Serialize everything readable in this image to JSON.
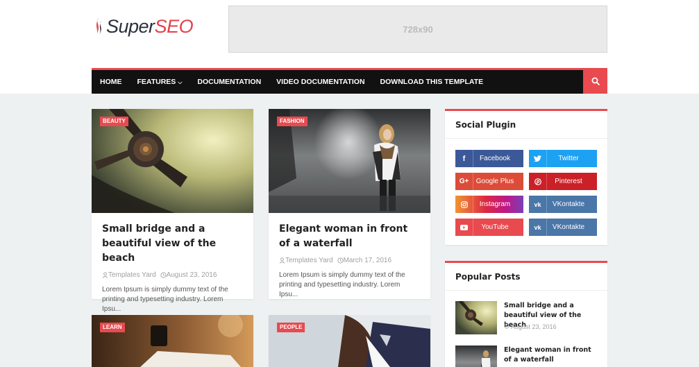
{
  "brand": {
    "logo_part1": "Super",
    "logo_part2": "SEO",
    "accent_color": "#e84a4f"
  },
  "ad": {
    "label": "728x90"
  },
  "nav": {
    "items": [
      {
        "label": "HOME"
      },
      {
        "label": "FEATURES",
        "has_dropdown": true
      },
      {
        "label": "DOCUMENTATION"
      },
      {
        "label": "VIDEO DOCUMENTATION"
      },
      {
        "label": "DOWNLOAD THIS TEMPLATE"
      }
    ],
    "search_icon": "search-icon"
  },
  "posts": [
    {
      "tag": "BEAUTY",
      "title": "Small bridge and a beautiful view of the beach",
      "author": "Templates Yard",
      "date": "August 23, 2016",
      "excerpt": "Lorem Ipsum is simply dummy text of the printing and typesetting industry. Lorem Ipsu..."
    },
    {
      "tag": "FASHION",
      "title": "Elegant woman in front of a waterfall",
      "author": "Templates Yard",
      "date": "March 17, 2016",
      "excerpt": "Lorem Ipsum is simply dummy text of the printing and typesetting industry. Lorem Ipsu..."
    },
    {
      "tag": "LEARN"
    },
    {
      "tag": "PEOPLE"
    }
  ],
  "sidebar": {
    "social": {
      "title": "Social Plugin",
      "buttons": [
        {
          "label": "Facebook",
          "icon": "facebook-icon",
          "color": "#3b5998"
        },
        {
          "label": "Twitter",
          "icon": "twitter-icon",
          "color": "#1da1f2"
        },
        {
          "label": "Google Plus",
          "icon": "google-plus-icon",
          "color": "#dd4b39"
        },
        {
          "label": "Pinterest",
          "icon": "pinterest-icon",
          "color": "#cb2027"
        },
        {
          "label": "Instagram",
          "icon": "instagram-icon",
          "color": "#c13584"
        },
        {
          "label": "VKontakte",
          "icon": "vk-icon",
          "color": "#4a76a8"
        },
        {
          "label": "YouTube",
          "icon": "youtube-icon",
          "color": "#e84a4f"
        },
        {
          "label": "VKontakte",
          "icon": "vk-icon",
          "color": "#4a76a8"
        }
      ]
    },
    "popular": {
      "title": "Popular Posts",
      "items": [
        {
          "title": "Small bridge and a beautiful view of the beach",
          "date": "August 23, 2016"
        },
        {
          "title": "Elegant woman in front of a waterfall"
        }
      ]
    }
  }
}
